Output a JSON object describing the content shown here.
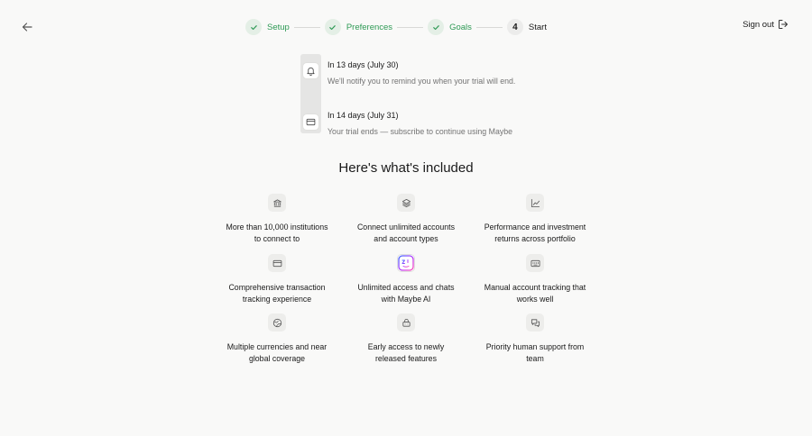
{
  "header": {
    "steps": [
      {
        "label": "Setup",
        "state": "done"
      },
      {
        "label": "Preferences",
        "state": "done"
      },
      {
        "label": "Goals",
        "state": "done"
      },
      {
        "label": "Start",
        "state": "current",
        "number": "4"
      }
    ],
    "sign_out_label": "Sign out"
  },
  "timeline": [
    {
      "title": "In 13 days (July 30)",
      "description": "We'll notify you to remind you when your trial will end.",
      "icon": "bell-icon"
    },
    {
      "title": "In 14 days (July 31)",
      "description": "Your trial ends — subscribe to continue using Maybe",
      "icon": "credit-card-icon"
    }
  ],
  "included": {
    "title": "Here's what's included",
    "features": [
      {
        "text_line1": "More than 10,000 institutions",
        "text_line2": "to connect to",
        "icon": "bank-icon"
      },
      {
        "text_line1": "Connect unlimited accounts",
        "text_line2": "and account types",
        "icon": "layers-icon"
      },
      {
        "text_line1": "Performance and investment",
        "text_line2": "returns across portfolio",
        "icon": "line-chart-icon"
      },
      {
        "text_line1": "Comprehensive transaction",
        "text_line2": "tracking experience",
        "icon": "credit-card-icon"
      },
      {
        "text_line1": "Unlimited access and chats",
        "text_line2": "with Maybe AI",
        "icon": "ai-face-icon"
      },
      {
        "text_line1": "Manual account tracking that",
        "text_line2": "works well",
        "icon": "keyboard-icon"
      },
      {
        "text_line1": "Multiple currencies and near",
        "text_line2": "global coverage",
        "icon": "globe-icon"
      },
      {
        "text_line1": "Early access to newly",
        "text_line2": "released features",
        "icon": "bot-icon"
      },
      {
        "text_line1": "Priority human support from",
        "text_line2": "team",
        "icon": "messages-icon"
      }
    ]
  },
  "colors": {
    "background": "#f9f9f8",
    "success": "#2e9a55",
    "muted_text": "#737373"
  }
}
